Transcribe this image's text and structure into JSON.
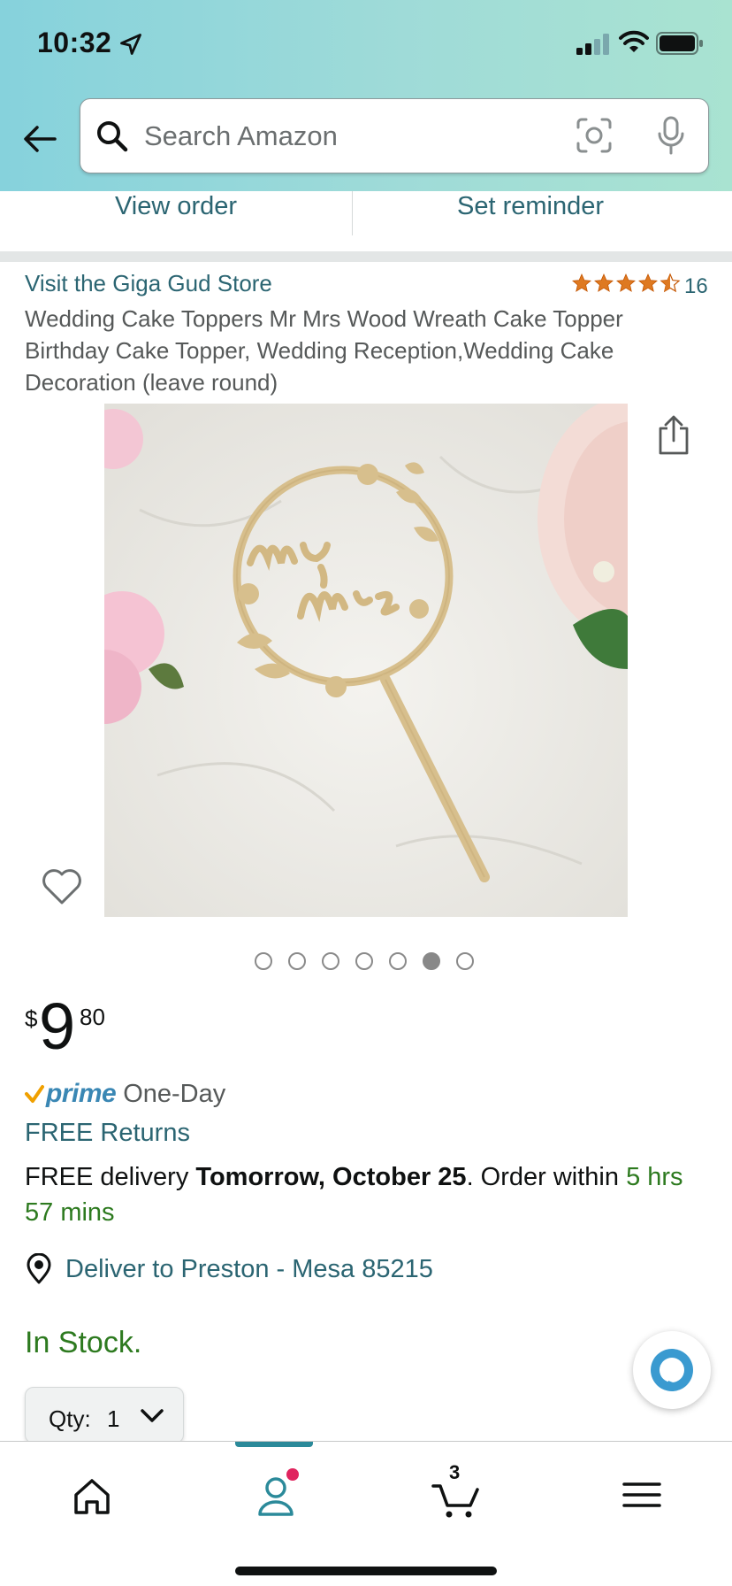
{
  "status_bar": {
    "time": "10:32"
  },
  "search": {
    "placeholder": "Search Amazon"
  },
  "order_actions": {
    "view_order": "View order",
    "set_reminder": "Set reminder"
  },
  "product": {
    "store_link": "Visit the Giga Gud Store",
    "rating_stars": 4.5,
    "rating_count": "16",
    "title": "Wedding Cake Toppers Mr Mrs Wood Wreath Cake Topper Birthday Cake Topper, Wedding Reception,Wedding Cake Decoration (leave round)",
    "image_count": 7,
    "active_image_index": 5
  },
  "price": {
    "symbol": "$",
    "whole": "9",
    "fraction": "80"
  },
  "prime": {
    "brand": "prime",
    "speed": "One-Day"
  },
  "free_returns": "FREE Returns",
  "delivery": {
    "prefix": "FREE delivery ",
    "date": "Tomorrow, October 25",
    "middle": ". Order within ",
    "countdown": "5 hrs 57 mins"
  },
  "deliver_to": "Deliver to Preston - Mesa 85215",
  "stock_status": "In Stock.",
  "quantity": {
    "label": "Qty:",
    "value": "1"
  },
  "bottom_nav": {
    "cart_count": "3",
    "active_tab": "you"
  },
  "colors": {
    "header_gradient_start": "#86d2dc",
    "header_gradient_end": "#a9e3d1",
    "link": "#2b6572",
    "in_stock_green": "#2d7a1f",
    "prime_blue": "#3a87b4",
    "star_orange": "#de7921",
    "notification": "#e0245e"
  }
}
